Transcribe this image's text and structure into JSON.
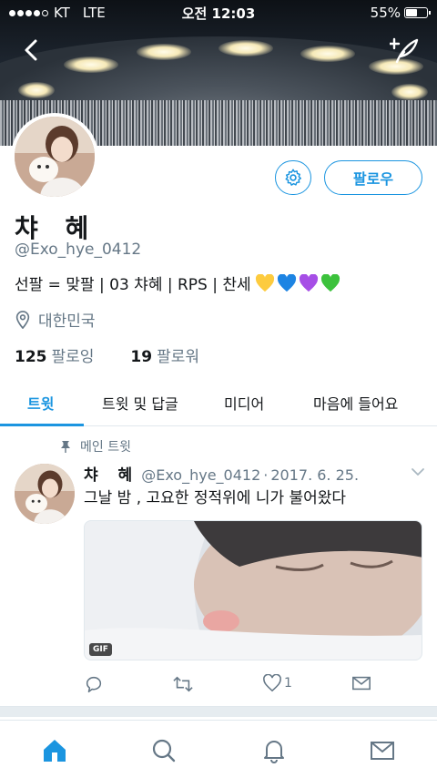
{
  "status_bar": {
    "carrier": "KT",
    "network": "LTE",
    "time": "오전 12:03",
    "battery": "55%",
    "battery_level": 0.55
  },
  "header": {
    "back_icon": "chevron-left-icon",
    "compose_icon": "compose-tweet-icon"
  },
  "profile": {
    "display_name": "챠 혜",
    "handle": "@Exo_hye_0412",
    "bio": "선팔 = 맞팔 | 03 챠혜 | RPS | 찬세",
    "bio_emoji": [
      "yellow-heart",
      "blue-heart",
      "purple-heart",
      "green-heart"
    ],
    "location": "대한민국",
    "following_count": "125",
    "following_label": "팔로잉",
    "followers_count": "19",
    "followers_label": "팔로워",
    "follow_button": "팔로우"
  },
  "tabs": [
    {
      "label": "트윗",
      "active": true
    },
    {
      "label": "트윗 및 답글",
      "active": false
    },
    {
      "label": "미디어",
      "active": false
    },
    {
      "label": "마음에 들어요",
      "active": false
    }
  ],
  "tweet": {
    "pinned_label": "메인 트윗",
    "author_name": "챠 혜",
    "author_handle": "@Exo_hye_0412",
    "separator": "·",
    "date": "2017. 6. 25.",
    "text": "그날 밤 , 고요한 정적위에 니가 불어왔다",
    "media_badge": "GIF",
    "like_count": "1"
  },
  "colors": {
    "accent": "#1b95e0",
    "secondary_text": "#657786",
    "divider": "#e6ecf0"
  },
  "bottom_nav": [
    "home-icon",
    "search-icon",
    "notifications-icon",
    "messages-icon"
  ]
}
